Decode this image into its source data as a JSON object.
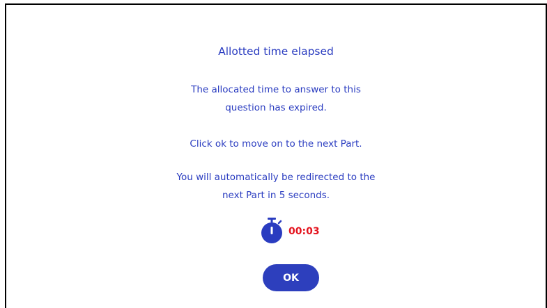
{
  "dialog": {
    "title": "Allotted time elapsed",
    "message_line1": "The allocated time to answer to this",
    "message_line2": "question has expired.",
    "instruction": "Click ok to move on to the next Part.",
    "redirect_line1": "You will automatically be redirected to the",
    "redirect_line2": "next Part in 5 seconds."
  },
  "timer": {
    "icon": "stopwatch-icon",
    "remaining": "00:03"
  },
  "actions": {
    "ok_label": "OK"
  },
  "colors": {
    "text_blue": "#2a3cc0",
    "button_blue": "#2d3fbd",
    "timer_red": "#e4141e",
    "border": "#000000",
    "background": "#ffffff"
  }
}
